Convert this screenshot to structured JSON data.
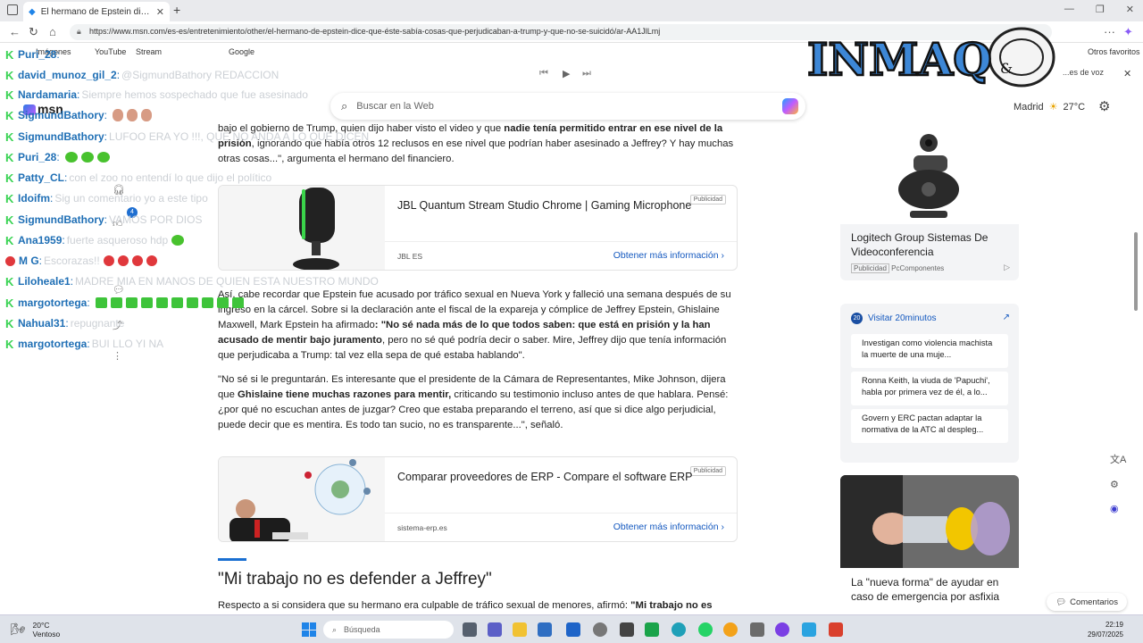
{
  "browser": {
    "tab_title": "El hermano de Epstein dice que é...",
    "url": "https://www.msn.com/es-es/entretenimiento/other/el-hermano-de-epstein-dice-que-éste-sabía-cosas-que-perjudicaban-a-trump-y-que-no-se-suicidó/ar-AA1JlLmj",
    "bookmarks": [
      "Imágenes",
      "YouTube",
      "Stream",
      "Google"
    ],
    "other_favorites": "Otros favoritos",
    "voice_label": "...es de voz"
  },
  "msn": {
    "logo": "msn",
    "search_placeholder": "Buscar en la Web",
    "weather_city": "Madrid",
    "weather_temp": "27°C"
  },
  "article": {
    "p1_a": "bajo el gobierno de Trump, quien dijo haber visto el video y que ",
    "p1_b": "nadie tenía permitido entrar en ese nivel de la prisión",
    "p1_c": ", ignorando que había otros 12 reclusos en ese nivel que podrían haber asesinado a Jeffrey? Y hay muchas otras cosas...\", argumenta el hermano del financiero.",
    "p2_a": "Así, cabe recordar que Epstein fue acusado por tráfico sexual en Nueva York y falleció una semana después de su ingreso en la cárcel. Sobre si la declaración ante el fiscal de la expareja y cómplice de Jeffrey Epstein, Ghislaine Maxwell, Mark Epstein ha afirmado",
    "p2_b": ": \"No sé nada más de lo que todos saben: que está en prisión y la han acusado de mentir bajo juramento",
    "p2_c": ", pero no sé qué podría decir o saber. Mire, Jeffrey dijo que tenía información que perjudicaba a Trump: tal vez ella sepa de qué estaba hablando\".",
    "p3_a": "\"No sé si le preguntarán. Es interesante que el presidente de la Cámara de Representantes, Mike Johnson, dijera que ",
    "p3_b": "Ghislaine tiene muchas razones para mentir,",
    "p3_c": " criticando su testimonio incluso antes de que hablara. Pensé: ¿por qué no escuchan antes de juzgar? Creo que estaba preparando el terreno, así que si dice algo perjudicial, puede decir que es mentira. Es todo tan sucio, no es transparente...\", señaló.",
    "h2": "\"Mi trabajo no es defender a Jeffrey\"",
    "p4_a": "Respecto a si considera que su hermano era culpable de tráfico sexual de menores, afirmó: ",
    "p4_b": "\"Mi trabajo no es"
  },
  "ads": [
    {
      "headline": "JBL Quantum Stream Studio Chrome | Gaming Microphone",
      "source": "JBL ES",
      "cta": "Obtener más información",
      "tag": "Publicidad"
    },
    {
      "headline": "Comparar proveedores de ERP - Compare el software ERP",
      "source": "sistema-erp.es",
      "cta": "Obtener más información",
      "tag": "Publicidad"
    }
  ],
  "right": {
    "card1_title": "Logitech Group Sistemas De Videoconferencia",
    "card1_tag": "Publicidad",
    "card1_source": "PcComponentes",
    "card2_header": "Visitar 20minutos",
    "card2_badge": "20",
    "news": [
      "Investigan como violencia machista la muerte de una muje...",
      "Ronna Keith, la viuda de 'Papuchi', habla por primera vez de él, a lo...",
      "Govern y ERC pactan adaptar la normativa de la ATC al despleg..."
    ],
    "card3_title": "La \"nueva forma\" de ayudar en caso de emergencia por asfixia",
    "comments": "Comentarios"
  },
  "chat": [
    {
      "user": "Puri_28",
      "msg": "",
      "badge": "k"
    },
    {
      "user": "david_munoz_gil_2",
      "msg": "@SigmundBathory REDACCION",
      "badge": "k"
    },
    {
      "user": "Nardamaria",
      "msg": "Siempre hemos sospechado que fue asesinado",
      "badge": "k"
    },
    {
      "user": "SigmundBathory",
      "msg": "",
      "badge": "k",
      "emotes": "skin3"
    },
    {
      "user": "SigmundBathory",
      "msg": "LUFOO ERA YO !!!, QUE NO ANDA A LO QUE DICEN",
      "badge": "k"
    },
    {
      "user": "Puri_28",
      "msg": "",
      "badge": "k",
      "emotes": "green3"
    },
    {
      "user": "Patty_CL",
      "msg": "con el zoo no entendí lo que dijo el político",
      "badge": "k"
    },
    {
      "user": "Idoifm",
      "msg": "Sig un comentario yo a este tipo",
      "badge": "k"
    },
    {
      "user": "SigmundBathory",
      "msg": "VAMOS POR DIOS",
      "badge": "k"
    },
    {
      "user": "Ana1959",
      "msg": "fuerte asqueroso hdp",
      "badge": "k",
      "emotes": "green1"
    },
    {
      "user": "M G",
      "msg": "Escorazas!!",
      "badge": "red",
      "emotes": "red4"
    },
    {
      "user": "Liloheale1",
      "msg": "MADRE MIA EN MANOS DE QUIEN ESTA NUESTRO MUNDO",
      "badge": "k"
    },
    {
      "user": "margotortega",
      "msg": "",
      "badge": "k",
      "emotes": "box10"
    },
    {
      "user": "Nahual31",
      "msg": "repugnante",
      "badge": "k"
    },
    {
      "user": "margotortega",
      "msg": "BUI LLO YI NA",
      "badge": "k"
    }
  ],
  "watermark": "INMAQ",
  "taskbar": {
    "temp": "20°C",
    "condition": "Ventoso",
    "search": "Búsqueda",
    "time": "22:19",
    "date": "29/07/2025"
  },
  "colors": {
    "chat_user": "#1f6fb5",
    "chat_badge": "#39d353",
    "link": "#1358bf",
    "accent": "#1a6fd1"
  }
}
